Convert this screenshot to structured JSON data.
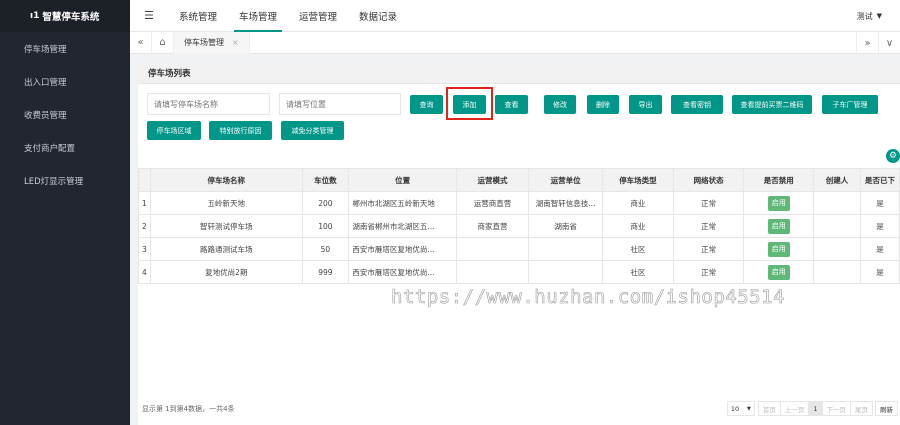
{
  "app": {
    "title": "智慧停车系统",
    "logo_mark": "ı1"
  },
  "sidebar": {
    "items": [
      {
        "label": "停车场管理"
      },
      {
        "label": "出入口管理"
      },
      {
        "label": "收费员管理"
      },
      {
        "label": "支付商户配置"
      },
      {
        "label": "LED灯显示管理"
      }
    ]
  },
  "header": {
    "menu_icon": "☰",
    "tabs": [
      {
        "label": "系统管理"
      },
      {
        "label": "车场管理",
        "active": true
      },
      {
        "label": "运营管理"
      },
      {
        "label": "数据记录"
      }
    ],
    "user": "测试",
    "user_caret": "▼"
  },
  "tabbar": {
    "prev_icon": "«",
    "home_icon": "⌂",
    "active_tab": "停车场管理",
    "close_icon": "×",
    "next_icon": "»",
    "more_icon": "∨"
  },
  "panel": {
    "title": "停车场列表"
  },
  "search": {
    "name_placeholder": "请填写停车场名称",
    "location_placeholder": "请填写位置"
  },
  "toolbar": {
    "query": "查询",
    "add": "添加",
    "view": "查看",
    "edit": "修改",
    "delete": "删除",
    "export": "导出",
    "view_key": "查看密钥",
    "view_qr": "查看提前买票二维码",
    "sub_lot": "子车厂管理",
    "area": "停车场区域",
    "special": "特别放行原因",
    "discount": "减免分类管理"
  },
  "table": {
    "columns": [
      "停车场名称",
      "车位数",
      "位置",
      "运营模式",
      "运营单位",
      "停车场类型",
      "网络状态",
      "是否禁用",
      "创建人",
      "是否已下"
    ],
    "rows": [
      {
        "idx": "1",
        "name": "五岭新天地",
        "spaces": "200",
        "location": "郴州市北湖区五岭新天地",
        "mode": "运营商直营",
        "unit": "湖南智轩信息技...",
        "type": "商业",
        "net": "正常",
        "disabled": "启用",
        "creator": "",
        "offline": "是"
      },
      {
        "idx": "2",
        "name": "智轩测试停车场",
        "spaces": "100",
        "location": "湖南省郴州市北湖区五...",
        "mode": "商家直营",
        "unit": "湖南省",
        "type": "商业",
        "net": "正常",
        "disabled": "启用",
        "creator": "",
        "offline": "是"
      },
      {
        "idx": "3",
        "name": "路路通测试车场",
        "spaces": "50",
        "location": "西安市雁塔区复地优尚...",
        "mode": "",
        "unit": "",
        "type": "社区",
        "net": "正常",
        "disabled": "启用",
        "creator": "",
        "offline": "是"
      },
      {
        "idx": "4",
        "name": "复地优尚2期",
        "spaces": "999",
        "location": "西安市雁塔区复地优尚...",
        "mode": "",
        "unit": "",
        "type": "社区",
        "net": "正常",
        "disabled": "启用",
        "creator": "",
        "offline": "是"
      }
    ]
  },
  "watermark": "https://www.huzhan.com/ishop45514",
  "footer": {
    "info": "显示第 1到第4数据，一共4条",
    "page_size": "10",
    "page_size_caret": "▼",
    "first": "首页",
    "prev": "上一页",
    "current": "1",
    "next": "下一页",
    "last": "尾页",
    "refresh": "刷新"
  },
  "colors": {
    "primary": "#009688",
    "sidebar": "#22272f",
    "enable": "#5fb878",
    "highlight": "#e0241a"
  },
  "icons": {
    "gear": "gear-icon"
  }
}
